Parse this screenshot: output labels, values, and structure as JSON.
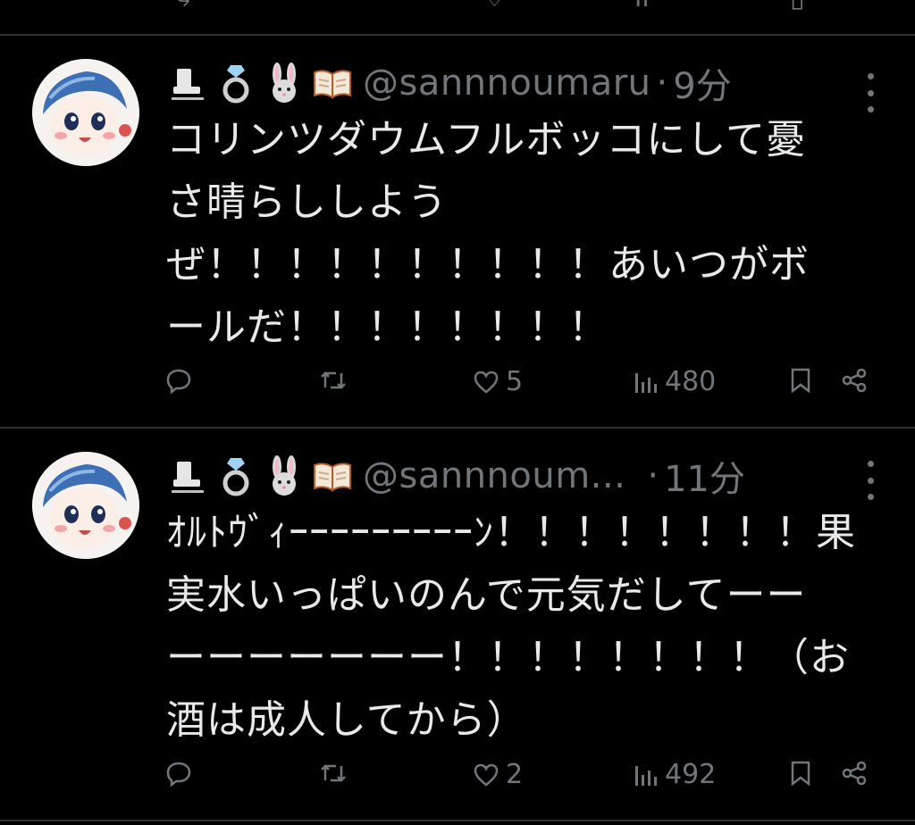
{
  "tweets": [
    {
      "handle": "@sannnoumaru",
      "separator": "·",
      "time": "9分",
      "lines": [
        "コリンツダウムフルボッコにして憂",
        "さ晴らししよう",
        "ぜ！！！！！！！！！！あいつがボ",
        "ールだ！！！！！！！！"
      ],
      "actions": {
        "reply_count": "",
        "retweet_count": "",
        "like_count": "5",
        "views": "480"
      }
    },
    {
      "handle": "@sannnoum...",
      "separator": "·",
      "time": "11分",
      "lines": [
        "ｵﾙﾄｳﾞｨｰｰｰｰｰｰｰｰｰﾝ！！！！！！！！果",
        "実水いっぱいのんで元気だしてーー",
        "ーーーーーーー！！！！！！！！（お",
        "酒は成人してから）"
      ],
      "actions": {
        "reply_count": "",
        "retweet_count": "",
        "like_count": "2",
        "views": "492"
      }
    }
  ],
  "emoji_icons": [
    "ice-skate-icon",
    "ring-icon",
    "rabbit-icon",
    "open-book-icon"
  ],
  "colors": {
    "background": "#000000",
    "text": "#e7e9ea",
    "secondary": "#71767b",
    "divider": "#2f3336"
  }
}
